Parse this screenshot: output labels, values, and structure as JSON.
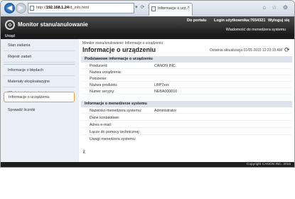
{
  "browser": {
    "address_prefix": "http://",
    "address_host": "192.168.1.24",
    "address_path": "/d_info.html",
    "tab_title": "Informacje o urz...",
    "tab_close": "×",
    "tools": "▾ ⟳ ✕",
    "chrome_icons": "⌂ ☆ ⚙"
  },
  "header": {
    "title": "Monitor stanu/anulowanie",
    "portal_link": "Do portalu",
    "login_label": "Login użytkownika:",
    "login_user": "7654321",
    "logout_link": "Wyloguj się",
    "admin_message": "Wiadomość do menedżera systemu",
    "subbar_label": "Urząd"
  },
  "sidebar": {
    "items": [
      {
        "label": "Stan zadania"
      },
      {
        "label": "Rejestr zadań"
      },
      {
        "label": "Informacje o błędach"
      },
      {
        "label": "Materiały eksploatacyjne"
      },
      {
        "label": "Właściwości urządzenia"
      },
      {
        "label": "Informacje o urządzeniu"
      },
      {
        "label": "Sprawdź liczniki"
      }
    ]
  },
  "main": {
    "breadcrumb": "Monitor stanu/anulowanie: Informacje o urządzeniu",
    "title": "Informacje o urządzeniu",
    "last_update": "Ostatnia aktualizacja 01/05 2015 12:23:15 AM",
    "device_section": {
      "heading": "Podstawowe informacje o urządzeniu",
      "rows": [
        {
          "key": "Producent:",
          "value": "CANON INC."
        },
        {
          "key": "Nazwa urządzenia:",
          "value": ""
        },
        {
          "key": "Położenie:",
          "value": ""
        },
        {
          "key": "Nazwa produktu:",
          "value": "LBP7xxx"
        },
        {
          "key": "Numer seryjny:",
          "value": "NEBA000010"
        }
      ]
    },
    "admin_section": {
      "heading": "Informacje o menedżerze systemu",
      "rows": [
        {
          "key": "Nazwisko menedżera systemu:",
          "value": "Administrator"
        },
        {
          "key": "Dane kontaktowe:",
          "value": ""
        },
        {
          "key": "Adres e-mail:",
          "value": ""
        },
        {
          "key": "Łącze do pomocy technicznej:",
          "value": ""
        },
        {
          "key": "Uwagi menedżera systemu:",
          "value": ""
        }
      ]
    },
    "to_top": "⊼"
  },
  "footer": {
    "copyright": "Copyright CANON INC. 2015"
  }
}
